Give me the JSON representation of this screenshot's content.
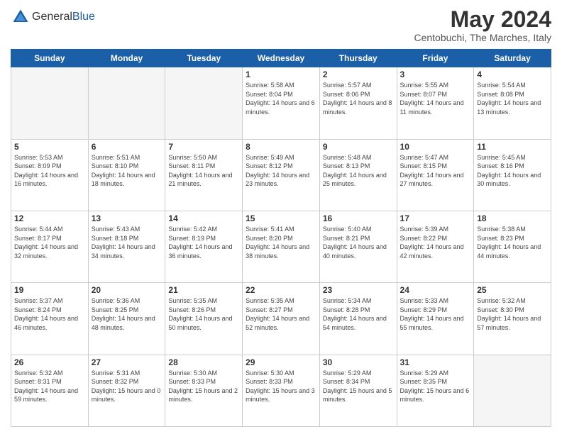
{
  "header": {
    "logo_general": "General",
    "logo_blue": "Blue",
    "month_title": "May 2024",
    "location": "Centobuchi, The Marches, Italy"
  },
  "weekdays": [
    "Sunday",
    "Monday",
    "Tuesday",
    "Wednesday",
    "Thursday",
    "Friday",
    "Saturday"
  ],
  "weeks": [
    [
      {
        "day": "",
        "info": ""
      },
      {
        "day": "",
        "info": ""
      },
      {
        "day": "",
        "info": ""
      },
      {
        "day": "1",
        "info": "Sunrise: 5:58 AM\nSunset: 8:04 PM\nDaylight: 14 hours\nand 6 minutes."
      },
      {
        "day": "2",
        "info": "Sunrise: 5:57 AM\nSunset: 8:06 PM\nDaylight: 14 hours\nand 8 minutes."
      },
      {
        "day": "3",
        "info": "Sunrise: 5:55 AM\nSunset: 8:07 PM\nDaylight: 14 hours\nand 11 minutes."
      },
      {
        "day": "4",
        "info": "Sunrise: 5:54 AM\nSunset: 8:08 PM\nDaylight: 14 hours\nand 13 minutes."
      }
    ],
    [
      {
        "day": "5",
        "info": "Sunrise: 5:53 AM\nSunset: 8:09 PM\nDaylight: 14 hours\nand 16 minutes."
      },
      {
        "day": "6",
        "info": "Sunrise: 5:51 AM\nSunset: 8:10 PM\nDaylight: 14 hours\nand 18 minutes."
      },
      {
        "day": "7",
        "info": "Sunrise: 5:50 AM\nSunset: 8:11 PM\nDaylight: 14 hours\nand 21 minutes."
      },
      {
        "day": "8",
        "info": "Sunrise: 5:49 AM\nSunset: 8:12 PM\nDaylight: 14 hours\nand 23 minutes."
      },
      {
        "day": "9",
        "info": "Sunrise: 5:48 AM\nSunset: 8:13 PM\nDaylight: 14 hours\nand 25 minutes."
      },
      {
        "day": "10",
        "info": "Sunrise: 5:47 AM\nSunset: 8:15 PM\nDaylight: 14 hours\nand 27 minutes."
      },
      {
        "day": "11",
        "info": "Sunrise: 5:45 AM\nSunset: 8:16 PM\nDaylight: 14 hours\nand 30 minutes."
      }
    ],
    [
      {
        "day": "12",
        "info": "Sunrise: 5:44 AM\nSunset: 8:17 PM\nDaylight: 14 hours\nand 32 minutes."
      },
      {
        "day": "13",
        "info": "Sunrise: 5:43 AM\nSunset: 8:18 PM\nDaylight: 14 hours\nand 34 minutes."
      },
      {
        "day": "14",
        "info": "Sunrise: 5:42 AM\nSunset: 8:19 PM\nDaylight: 14 hours\nand 36 minutes."
      },
      {
        "day": "15",
        "info": "Sunrise: 5:41 AM\nSunset: 8:20 PM\nDaylight: 14 hours\nand 38 minutes."
      },
      {
        "day": "16",
        "info": "Sunrise: 5:40 AM\nSunset: 8:21 PM\nDaylight: 14 hours\nand 40 minutes."
      },
      {
        "day": "17",
        "info": "Sunrise: 5:39 AM\nSunset: 8:22 PM\nDaylight: 14 hours\nand 42 minutes."
      },
      {
        "day": "18",
        "info": "Sunrise: 5:38 AM\nSunset: 8:23 PM\nDaylight: 14 hours\nand 44 minutes."
      }
    ],
    [
      {
        "day": "19",
        "info": "Sunrise: 5:37 AM\nSunset: 8:24 PM\nDaylight: 14 hours\nand 46 minutes."
      },
      {
        "day": "20",
        "info": "Sunrise: 5:36 AM\nSunset: 8:25 PM\nDaylight: 14 hours\nand 48 minutes."
      },
      {
        "day": "21",
        "info": "Sunrise: 5:35 AM\nSunset: 8:26 PM\nDaylight: 14 hours\nand 50 minutes."
      },
      {
        "day": "22",
        "info": "Sunrise: 5:35 AM\nSunset: 8:27 PM\nDaylight: 14 hours\nand 52 minutes."
      },
      {
        "day": "23",
        "info": "Sunrise: 5:34 AM\nSunset: 8:28 PM\nDaylight: 14 hours\nand 54 minutes."
      },
      {
        "day": "24",
        "info": "Sunrise: 5:33 AM\nSunset: 8:29 PM\nDaylight: 14 hours\nand 55 minutes."
      },
      {
        "day": "25",
        "info": "Sunrise: 5:32 AM\nSunset: 8:30 PM\nDaylight: 14 hours\nand 57 minutes."
      }
    ],
    [
      {
        "day": "26",
        "info": "Sunrise: 5:32 AM\nSunset: 8:31 PM\nDaylight: 14 hours\nand 59 minutes."
      },
      {
        "day": "27",
        "info": "Sunrise: 5:31 AM\nSunset: 8:32 PM\nDaylight: 15 hours\nand 0 minutes."
      },
      {
        "day": "28",
        "info": "Sunrise: 5:30 AM\nSunset: 8:33 PM\nDaylight: 15 hours\nand 2 minutes."
      },
      {
        "day": "29",
        "info": "Sunrise: 5:30 AM\nSunset: 8:33 PM\nDaylight: 15 hours\nand 3 minutes."
      },
      {
        "day": "30",
        "info": "Sunrise: 5:29 AM\nSunset: 8:34 PM\nDaylight: 15 hours\nand 5 minutes."
      },
      {
        "day": "31",
        "info": "Sunrise: 5:29 AM\nSunset: 8:35 PM\nDaylight: 15 hours\nand 6 minutes."
      },
      {
        "day": "",
        "info": ""
      }
    ]
  ]
}
